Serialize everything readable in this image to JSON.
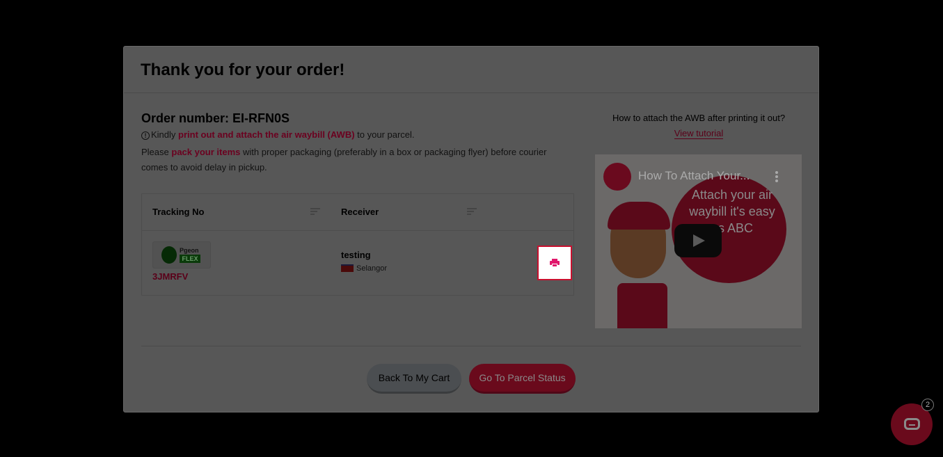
{
  "modal": {
    "title": "Thank you for your order!",
    "order_number": "Order number: EI-RFN0S",
    "line1_prefix": "Kindly ",
    "line1_highlight": "print out and attach the air waybill (AWB)",
    "line1_suffix": " to your parcel.",
    "line2_prefix": "Please ",
    "line2_highlight": "pack your items",
    "line2_suffix": " with proper packaging (preferably in a box or packaging flyer) before courier comes to avoid delay in pickup."
  },
  "table": {
    "headers": [
      "Tracking No",
      "Receiver"
    ],
    "rows": [
      {
        "courier_top": "Pgeon",
        "courier_bottom": "FLEX",
        "tracking_no": "3JMRFV",
        "receiver_name": "testing",
        "receiver_state": "Selangor"
      }
    ]
  },
  "tutorial": {
    "question": "How to attach the AWB after printing it out?",
    "link": "View tutorial"
  },
  "video": {
    "title": "How To Attach Your...",
    "overlay_text": "Attach your air waybill it's easy as ABC",
    "channel_logo": "easy"
  },
  "actions": {
    "back_label": "Back To My Cart",
    "go_label": "Go To Parcel Status"
  },
  "chat": {
    "badge": "2"
  },
  "colors": {
    "accent": "#c8102e",
    "print_icon": "#e0176b",
    "overlay": "#000000"
  }
}
